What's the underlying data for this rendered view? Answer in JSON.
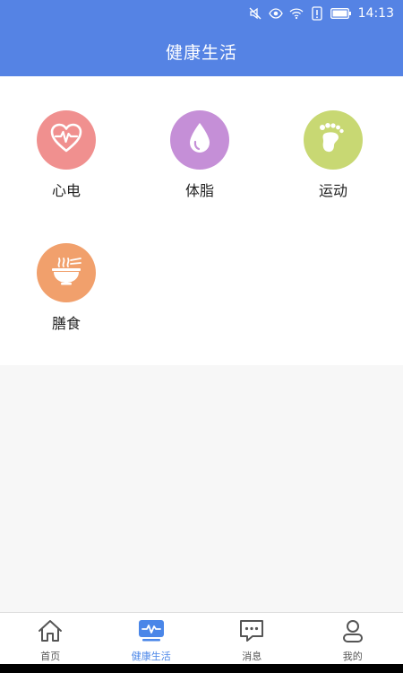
{
  "status_bar": {
    "time": "14:13"
  },
  "header": {
    "title": "健康生活"
  },
  "tiles": [
    {
      "label": "心电",
      "icon": "heart-ecg-icon",
      "color": "#f0908f"
    },
    {
      "label": "体脂",
      "icon": "water-drop-icon",
      "color": "#c58fd7"
    },
    {
      "label": "运动",
      "icon": "footprint-icon",
      "color": "#c8d873"
    },
    {
      "label": "膳食",
      "icon": "food-bowl-icon",
      "color": "#f1a06c"
    }
  ],
  "tabbar": {
    "items": [
      {
        "label": "首页",
        "icon": "home-icon",
        "active": false
      },
      {
        "label": "健康生活",
        "icon": "health-monitor-icon",
        "active": true
      },
      {
        "label": "消息",
        "icon": "chat-bubble-icon",
        "active": false
      },
      {
        "label": "我的",
        "icon": "profile-icon",
        "active": false
      }
    ],
    "active_color": "#4a86e8"
  },
  "colors": {
    "header_bg": "#5583e4"
  }
}
